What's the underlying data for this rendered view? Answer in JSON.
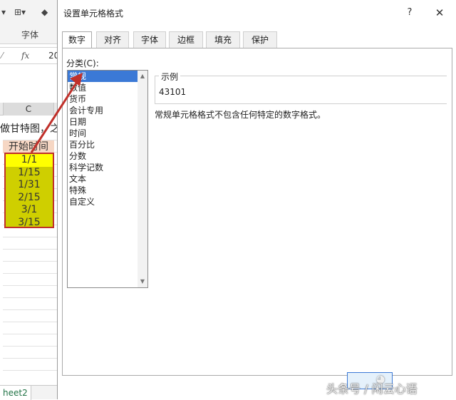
{
  "excel": {
    "ribbon_font_label": "字体",
    "fx_label": "fx",
    "formula_value": "20",
    "column_header": "C",
    "note_text": "做甘特图，之",
    "start_header": "开始时间",
    "dates": [
      "1/1",
      "1/15",
      "1/31",
      "2/15",
      "3/1",
      "3/15"
    ],
    "sheet_tab": "heet2"
  },
  "dialog": {
    "title": "设置单元格格式",
    "help": "?",
    "close": "✕",
    "tabs": [
      "数字",
      "对齐",
      "字体",
      "边框",
      "填充",
      "保护"
    ],
    "active_tab": 0,
    "category_label": "分类(C):",
    "categories": [
      "常规",
      "数值",
      "货币",
      "会计专用",
      "日期",
      "时间",
      "百分比",
      "分数",
      "科学记数",
      "文本",
      "特殊",
      "自定义"
    ],
    "selected_category": 0,
    "sample_legend": "示例",
    "sample_value": "43101",
    "description": "常规单元格格式不包含任何特定的数字格式。"
  },
  "watermark": {
    "text": "头条号 / 闲云心语",
    "icon": "wechat-icon"
  },
  "colors": {
    "selection": "#3b79d6",
    "highlight_yellow": "#ffff00",
    "cell_olive": "#cfcf00",
    "annotation_red": "#c0302a",
    "header_peach": "#f6d7c4"
  }
}
